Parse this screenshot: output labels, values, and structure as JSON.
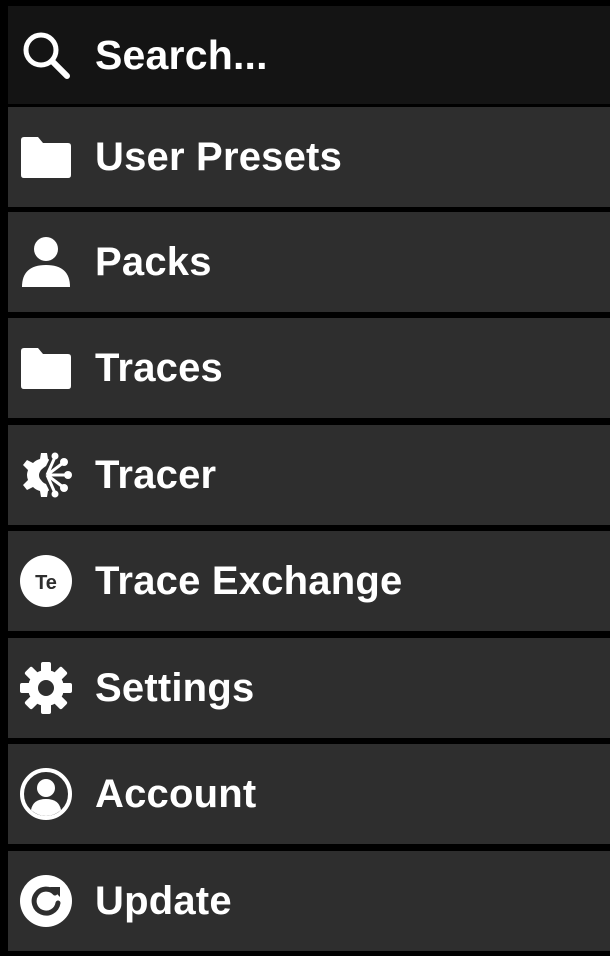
{
  "search": {
    "label": "Search...",
    "icon": "search-icon"
  },
  "menu": {
    "items": [
      {
        "label": "User Presets",
        "icon": "folder-icon"
      },
      {
        "label": "Packs",
        "icon": "person-icon"
      },
      {
        "label": "Traces",
        "icon": "folder-icon"
      },
      {
        "label": "Tracer",
        "icon": "tracer-icon"
      },
      {
        "label": "Trace Exchange",
        "icon": "trace-exchange-icon",
        "icon_text": "Te"
      },
      {
        "label": "Settings",
        "icon": "gear-icon"
      },
      {
        "label": "Account",
        "icon": "account-circle-icon"
      },
      {
        "label": "Update",
        "icon": "refresh-icon"
      }
    ]
  },
  "colors": {
    "background": "#000000",
    "row": "#2e2e2e",
    "search_row": "#141414",
    "text": "#ffffff"
  }
}
